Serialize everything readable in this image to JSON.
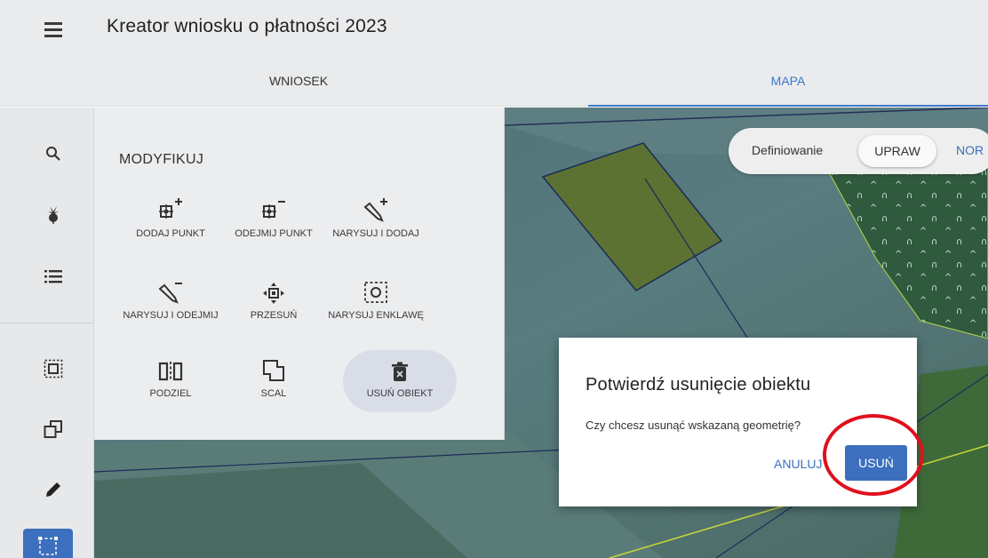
{
  "app": {
    "title": "Kreator wniosku o płatności 2023"
  },
  "tabs": [
    {
      "label": "WNIOSEK"
    },
    {
      "label": "MAPA"
    }
  ],
  "side_rail": {
    "icons": [
      "search-icon",
      "beet-icon",
      "list-icon",
      "select-area-icon",
      "copy-shapes-icon",
      "pencil-icon",
      "draw-rectangle-icon"
    ]
  },
  "panel": {
    "title": "MODYFIKUJ",
    "tools": [
      {
        "label": "DODAJ PUNKT",
        "icon": "add-vertex-icon"
      },
      {
        "label": "ODEJMIJ PUNKT",
        "icon": "remove-vertex-icon"
      },
      {
        "label": "NARYSUJ I DODAJ",
        "icon": "draw-add-icon"
      },
      {
        "label": "NARYSUJ I ODEJMIJ",
        "icon": "draw-subtract-icon"
      },
      {
        "label": "PRZESUŃ",
        "icon": "move-icon"
      },
      {
        "label": "NARYSUJ ENKLAWĘ",
        "icon": "draw-enclave-icon"
      },
      {
        "label": "PODZIEL",
        "icon": "split-icon"
      },
      {
        "label": "SCAL",
        "icon": "merge-icon"
      },
      {
        "label": "USUŃ OBIEKT",
        "icon": "delete-object-icon"
      }
    ]
  },
  "map_toolbar": {
    "label": "Definiowanie",
    "chip": "UPRAW",
    "next": "NOR"
  },
  "dialog": {
    "title": "Potwierdź usunięcie obiektu",
    "message": "Czy chcesz usunąć wskazaną geometrię?",
    "cancel": "ANULUJ",
    "confirm": "USUŃ"
  },
  "colors": {
    "accent": "#3c6fbe",
    "highlight_circle": "#e0101c"
  }
}
